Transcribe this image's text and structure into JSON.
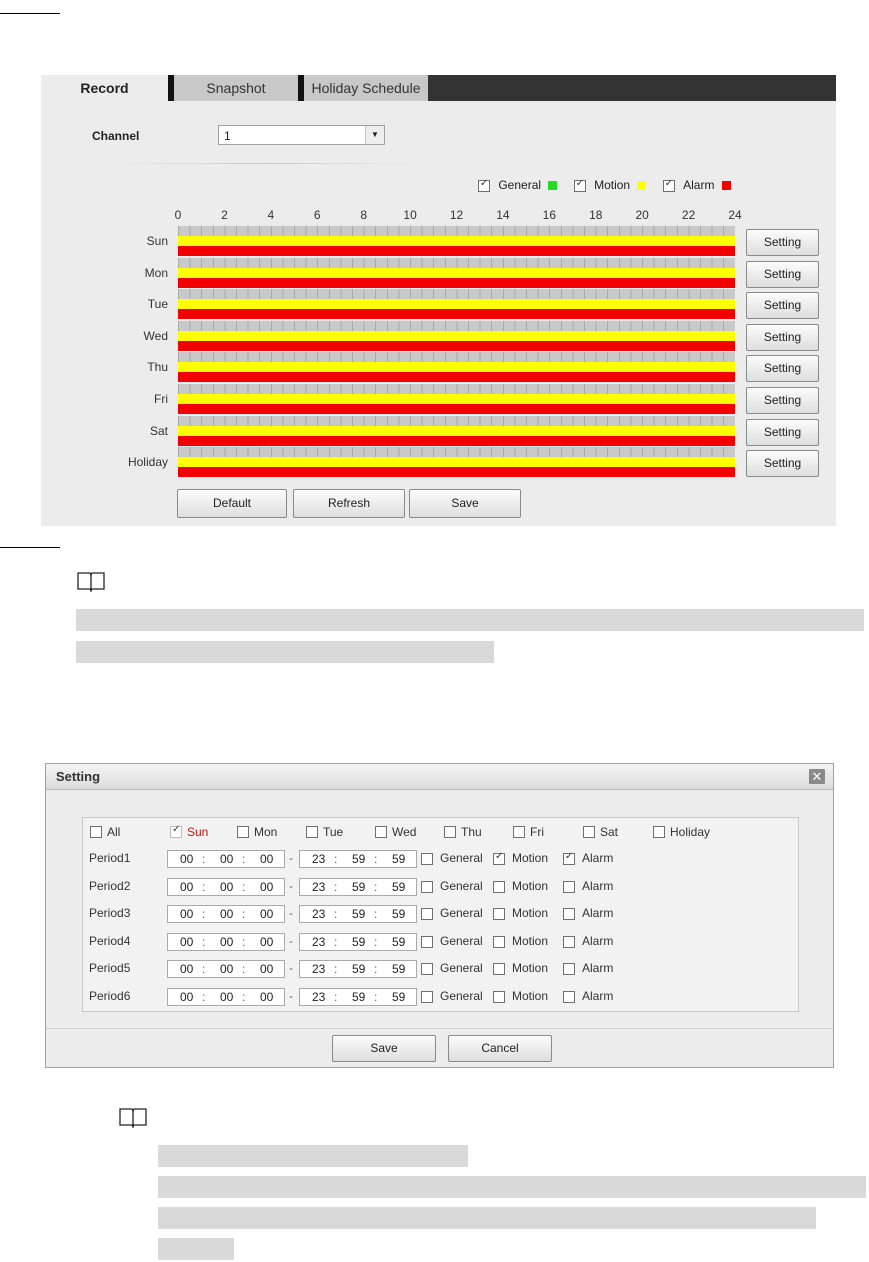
{
  "record_panel": {
    "tabs": [
      "Record",
      "Snapshot",
      "Holiday Schedule"
    ],
    "channel_label": "Channel",
    "channel_value": "1",
    "legend": [
      {
        "label": "General",
        "checked": true,
        "color": "#22dd22"
      },
      {
        "label": "Motion",
        "checked": true,
        "color": "#ffff00"
      },
      {
        "label": "Alarm",
        "checked": true,
        "color": "#f20000"
      }
    ],
    "hour_ticks": [
      "0",
      "2",
      "4",
      "6",
      "8",
      "10",
      "12",
      "14",
      "16",
      "18",
      "20",
      "22",
      "24"
    ],
    "days": [
      "Sun",
      "Mon",
      "Tue",
      "Wed",
      "Thu",
      "Fri",
      "Sat",
      "Holiday"
    ],
    "setting_label": "Setting",
    "buttons": {
      "default": "Default",
      "refresh": "Refresh",
      "save": "Save"
    }
  },
  "dialog": {
    "title": "Setting",
    "close_icon": "close-icon",
    "day_options": [
      {
        "label": "All",
        "checked": false
      },
      {
        "label": "Sun",
        "checked": true
      },
      {
        "label": "Mon",
        "checked": false
      },
      {
        "label": "Tue",
        "checked": false
      },
      {
        "label": "Wed",
        "checked": false
      },
      {
        "label": "Thu",
        "checked": false
      },
      {
        "label": "Fri",
        "checked": false
      },
      {
        "label": "Sat",
        "checked": false
      },
      {
        "label": "Holiday",
        "checked": false
      }
    ],
    "periods": [
      {
        "label": "Period1",
        "start": [
          "00",
          "00",
          "00"
        ],
        "end": [
          "23",
          "59",
          "59"
        ],
        "general": false,
        "motion": true,
        "alarm": true
      },
      {
        "label": "Period2",
        "start": [
          "00",
          "00",
          "00"
        ],
        "end": [
          "23",
          "59",
          "59"
        ],
        "general": false,
        "motion": false,
        "alarm": false
      },
      {
        "label": "Period3",
        "start": [
          "00",
          "00",
          "00"
        ],
        "end": [
          "23",
          "59",
          "59"
        ],
        "general": false,
        "motion": false,
        "alarm": false
      },
      {
        "label": "Period4",
        "start": [
          "00",
          "00",
          "00"
        ],
        "end": [
          "23",
          "59",
          "59"
        ],
        "general": false,
        "motion": false,
        "alarm": false
      },
      {
        "label": "Period5",
        "start": [
          "00",
          "00",
          "00"
        ],
        "end": [
          "23",
          "59",
          "59"
        ],
        "general": false,
        "motion": false,
        "alarm": false
      },
      {
        "label": "Period6",
        "start": [
          "00",
          "00",
          "00"
        ],
        "end": [
          "23",
          "59",
          "59"
        ],
        "general": false,
        "motion": false,
        "alarm": false
      }
    ],
    "type_labels": {
      "general": "General",
      "motion": "Motion",
      "alarm": "Alarm"
    },
    "time_sep": ":",
    "range_sep": "-",
    "save_label": "Save",
    "cancel_label": "Cancel"
  },
  "icons": {
    "note_1": "book-icon",
    "note_2": "book-icon"
  }
}
